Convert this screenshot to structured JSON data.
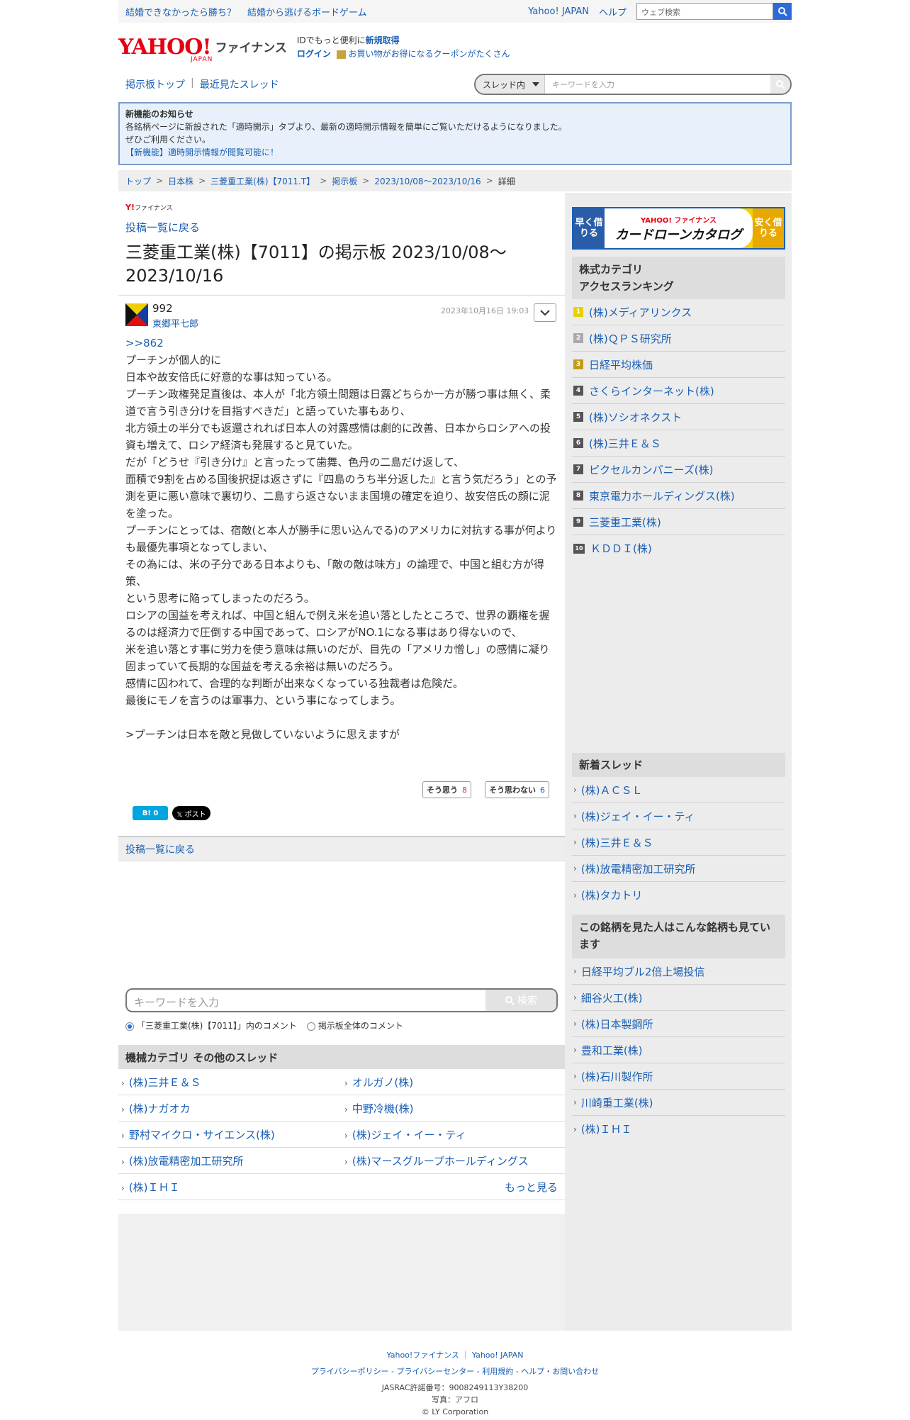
{
  "topbar": {
    "links": [
      "結婚できなかったら勝ち？",
      "結婚から逃げるボードゲーム"
    ],
    "yahoo_japan": "Yahoo! JAPAN",
    "help": "ヘルプ",
    "search_placeholder": "ウェブ検索"
  },
  "header": {
    "logo_text": "YAHOO!",
    "logo_sub": "JAPAN",
    "logo_finance": "ファイナンス",
    "line1_prefix": "IDでもっと便利に",
    "line1_link": "新規取得",
    "login": "ログイン",
    "coupon_text": "お買い物がお得になるクーポンがたくさん"
  },
  "board_nav": {
    "top": "掲示板トップ",
    "sep": "|",
    "recent": "最近見たスレッド",
    "select_label": "スレッド内",
    "keyword_placeholder": "キーワードを入力"
  },
  "notice": {
    "title": "新機能のお知らせ",
    "line1": "各銘柄ページに新設された「適時開示」タブより、最新の適時開示情報を簡単にご覧いただけるようになりました。",
    "line2": "ぜひご利用ください。",
    "link": "【新機能】適時開示情報が閲覧可能に！"
  },
  "breadcrumb": [
    "トップ",
    "日本株",
    "三菱重工業(株)【7011.T】",
    "掲示板",
    "2023/10/08〜2023/10/16",
    "詳細"
  ],
  "post": {
    "brand_small_y": "Y!",
    "brand_small": "ファイナンス",
    "back_link": "投稿一覧に戻る",
    "title": "三菱重工業(株)【7011】の掲示板 2023/10/08〜2023/10/16",
    "number": "992",
    "user": "東郷平七郎",
    "date": "2023年10月16日 19:03",
    "reply_to": ">>862",
    "body": "プーチンが個人的に\n日本や故安倍氏に好意的な事は知っている。\nプーチン政権発足直後は、本人が「北方領土問題は日露どちらか一方が勝つ事は無く、柔道で言う引き分けを目指すべきだ」と語っていた事もあり、\n北方領土の半分でも返還されれば日本人の対露感情は劇的に改善、日本からロシアへの投資も増えて、ロシア経済も発展すると見ていた。\nだが「どうせ『引き分け』と言ったって歯舞、色丹の二島だけ返して、\n面積で9割を占める国後択捉は返さずに『四島のうち半分返した』と言う気だろう」との予測を更に悪い意味で裏切り、二島すら返さないまま国境の確定を迫り、故安倍氏の顔に泥を塗った。\nプーチンにとっては、宿敵(と本人が勝手に思い込んでる)のアメリカに対抗する事が何よりも最優先事項となってしまい、\nその為には、米の子分である日本よりも、「敵の敵は味方」の論理で、中国と組む方が得策、\nという思考に陥ってしまったのだろう。\nロシアの国益を考えれば、中国と組んで例え米を追い落としたところで、世界の覇権を握るのは経済力で圧倒する中国であって、ロシアがNO.1になる事はあり得ないので、\n米を追い落とす事に労力を使う意味は無いのだが、目先の「アメリカ憎し」の感情に凝り固まっていて長期的な国益を考える余裕は無いのだろう。\n感情に囚われて、合理的な判断が出来なくなっている独裁者は危険だ。\n最後にモノを言うのは軍事力、という事になってしまう。",
    "quote": ">プーチンは日本を敵と見做していないように思えますが",
    "agree_label": "そう思う",
    "agree_count": "8",
    "disagree_label": "そう思わない",
    "disagree_count": "6",
    "hatena_label": "B! 0",
    "x_label": "𝕏 ポスト",
    "back_link_bottom": "投稿一覧に戻る"
  },
  "comment_search": {
    "placeholder": "キーワードを入力",
    "button": "検索",
    "radio1": "「三菱重工業(株)【7011】」内のコメント",
    "radio2": "掲示板全体のコメント"
  },
  "other_threads": {
    "title": "機械カテゴリ その他のスレッド",
    "items": [
      "(株)三井Ｅ＆Ｓ",
      "オルガノ(株)",
      "(株)ナガオカ",
      "中野冷機(株)",
      "野村マイクロ・サイエンス(株)",
      "(株)ジェイ・イー・ティ",
      "(株)放電精密加工研究所",
      "(株)マースグループホールディングス",
      "(株)ＩＨＩ"
    ],
    "more": "もっと見る"
  },
  "sidebar": {
    "ad": {
      "left": "早く借りる",
      "brand": "YAHOO! ファイナンス",
      "title": "カードローンカタログ",
      "right": "安く借りる"
    },
    "ranking_title": "株式カテゴリ\nアクセスランキング",
    "ranking": [
      "(株)メディアリンクス",
      "(株)ＱＰＳ研究所",
      "日経平均株価",
      "さくらインターネット(株)",
      "(株)ソシオネクスト",
      "(株)三井Ｅ＆Ｓ",
      "ピクセルカンパニーズ(株)",
      "東京電力ホールディングス(株)",
      "三菱重工業(株)",
      "ＫＤＤＩ(株)"
    ],
    "rank_nums": [
      "1",
      "2",
      "3",
      "4",
      "5",
      "6",
      "7",
      "8",
      "9",
      "10"
    ],
    "new_title": "新着スレッド",
    "new_threads": [
      "(株)ＡＣＳＬ",
      "(株)ジェイ・イー・ティ",
      "(株)三井Ｅ＆Ｓ",
      "(株)放電精密加工研究所",
      "(株)タカトリ"
    ],
    "also_title": "この銘柄を見た人はこんな銘柄も見ています",
    "also": [
      "日経平均ブル2倍上場投信",
      "細谷火工(株)",
      "(株)日本製鋼所",
      "豊和工業(株)",
      "(株)石川製作所",
      "川崎重工業(株)",
      "(株)ＩＨＩ"
    ]
  },
  "footer": {
    "line1": "Yahoo!ファイナンス ｜ Yahoo! JAPAN",
    "line2": "プライバシーポリシー - プライバシーセンター - 利用規約 - ヘルプ・お問い合わせ",
    "jasrac": "JASRAC許諾番号：9008249113Y38200",
    "photo": "写真：アフロ",
    "copyright": "© LY Corporation"
  }
}
